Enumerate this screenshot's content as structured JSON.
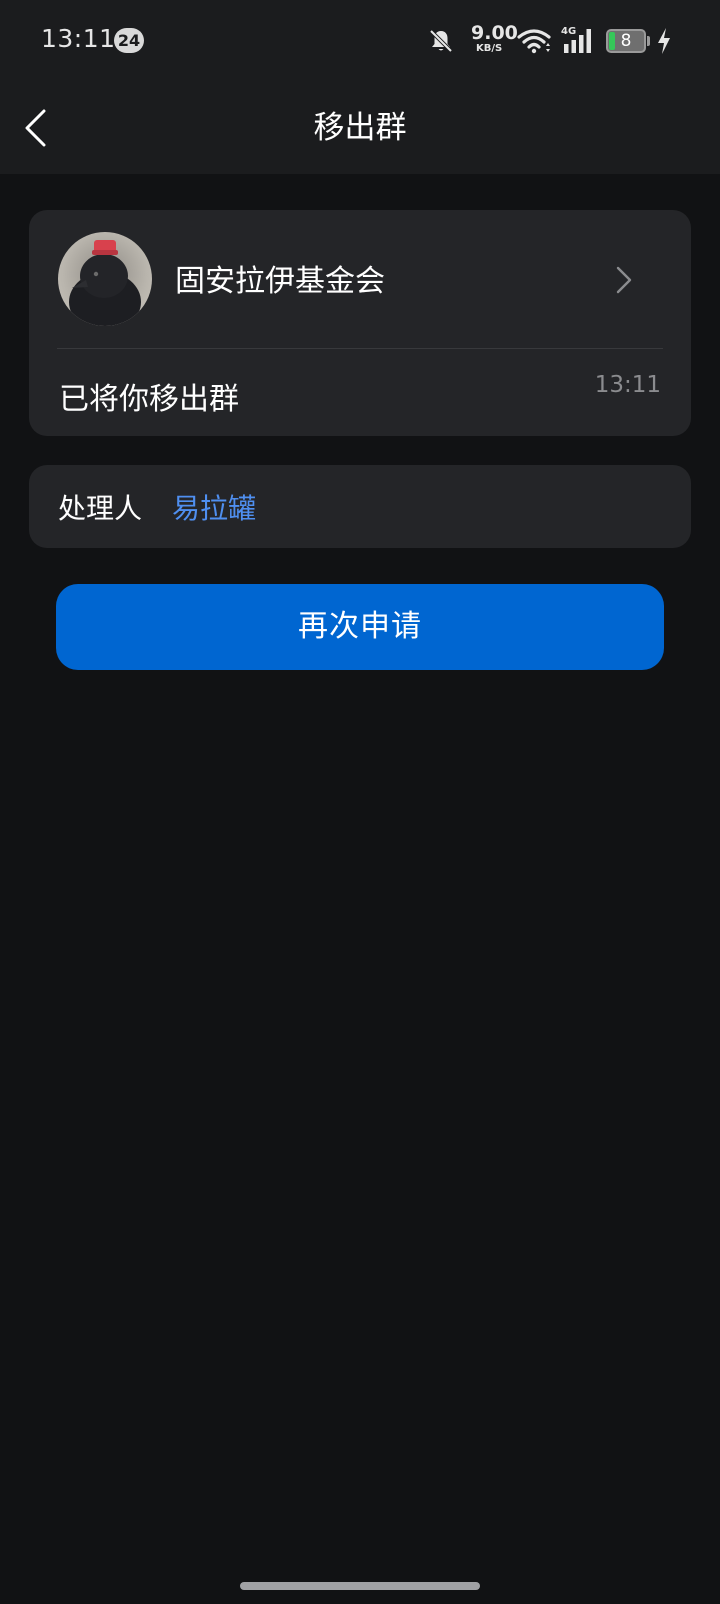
{
  "status_bar": {
    "time": "13:11",
    "notification_count": "24",
    "net_speed": "9.00",
    "net_speed_unit": "KB/S",
    "network_type": "4G",
    "battery_level": "8",
    "icons": [
      "bell-muted-icon",
      "wifi-icon",
      "signal-icon",
      "battery-icon",
      "charging-icon"
    ]
  },
  "header": {
    "title": "移出群",
    "back_icon": "chevron-left-icon"
  },
  "group_card": {
    "group_name": "固安拉伊基金会",
    "message": "已将你移出群",
    "time": "13:11",
    "chevron_icon": "chevron-right-icon"
  },
  "handler_card": {
    "label": "处理人",
    "name": "易拉罐"
  },
  "actions": {
    "reapply_label": "再次申请"
  },
  "colors": {
    "background": "#111214",
    "card": "#242528",
    "accent_button": "#0066d1",
    "link": "#4f8ff0",
    "battery_low": "#35c759"
  }
}
